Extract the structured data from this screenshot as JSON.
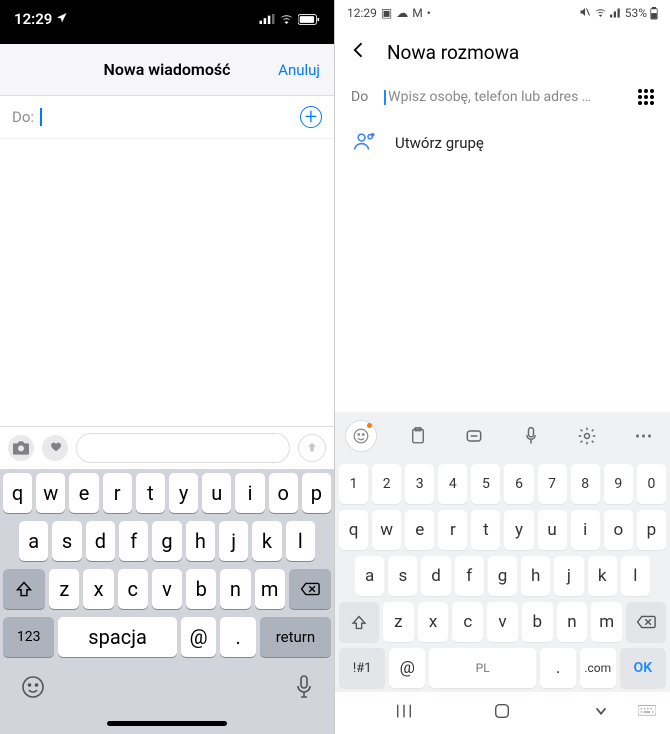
{
  "ios": {
    "status": {
      "time": "12:29"
    },
    "header": {
      "title": "Nowa wiadomość",
      "cancel": "Anuluj"
    },
    "to": {
      "label": "Do:"
    },
    "keyboard": {
      "row1": [
        "q",
        "w",
        "e",
        "r",
        "t",
        "y",
        "u",
        "i",
        "o",
        "p"
      ],
      "row2": [
        "a",
        "s",
        "d",
        "f",
        "g",
        "h",
        "j",
        "k",
        "l"
      ],
      "row3": [
        "z",
        "x",
        "c",
        "v",
        "b",
        "n",
        "m"
      ],
      "numKey": "123",
      "space": "spacja",
      "at": "@",
      "dot": ".",
      "return": "return"
    }
  },
  "android": {
    "status": {
      "time": "12:29",
      "battery": "53%"
    },
    "header": {
      "title": "Nowa rozmowa"
    },
    "to": {
      "label": "Do",
      "placeholder": "Wpisz osobę, telefon lub adres …"
    },
    "group": {
      "label": "Utwórz grupę"
    },
    "keyboard": {
      "nums": [
        "1",
        "2",
        "3",
        "4",
        "5",
        "6",
        "7",
        "8",
        "9",
        "0"
      ],
      "row1": [
        "q",
        "w",
        "e",
        "r",
        "t",
        "y",
        "u",
        "i",
        "o",
        "p"
      ],
      "row2": [
        "a",
        "s",
        "d",
        "f",
        "g",
        "h",
        "j",
        "k",
        "l"
      ],
      "row3": [
        "z",
        "x",
        "c",
        "v",
        "b",
        "n",
        "m"
      ],
      "sym": "!#1",
      "at": "@",
      "space": "PL",
      "dot": ".",
      "com": ".com",
      "ok": "OK"
    }
  }
}
